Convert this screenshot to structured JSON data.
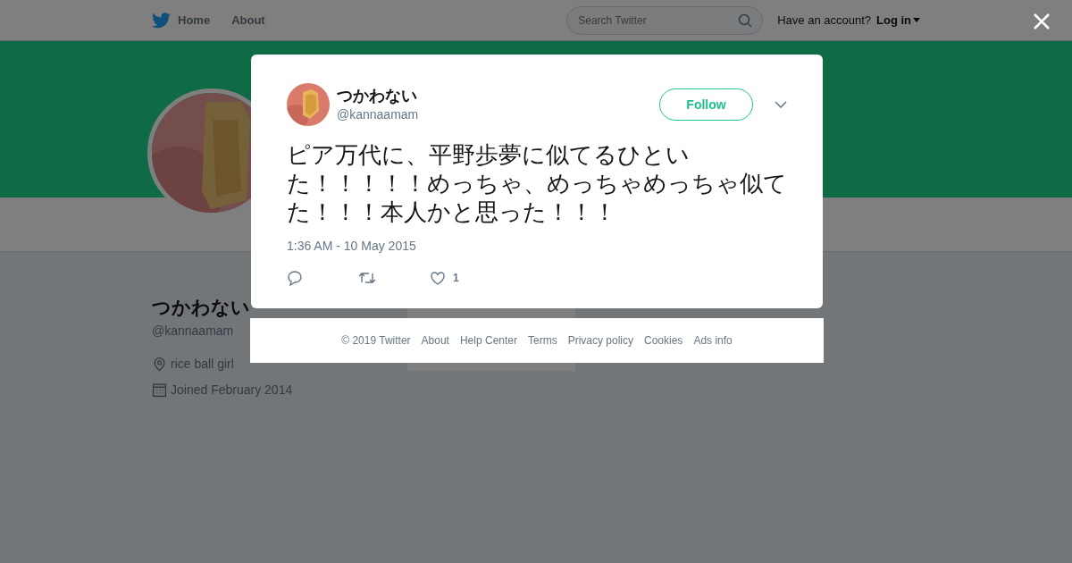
{
  "nav": {
    "links": [
      "Home",
      "About"
    ],
    "search": {
      "placeholder": "Search Twitter"
    },
    "account_prompt": "Have an account?",
    "login": "Log in"
  },
  "profile": {
    "name": "つかわない",
    "handle": "@kannaamam",
    "location": "rice ball girl",
    "joined": "Joined February 2014"
  },
  "tweet": {
    "name": "つかわない",
    "handle": "@kannaamam",
    "follow": "Follow",
    "text": "ピア万代に、平野歩夢に似てるひといた！！！！！めっちゃ、めっちゃめっちゃ似てた！！！本人かと思った！！！",
    "time": "1:36 AM - 10 May 2015",
    "like_count": "1"
  },
  "footer": [
    "© 2019 Twitter",
    "About",
    "Help Center",
    "Terms",
    "Privacy policy",
    "Cookies",
    "Ads info"
  ]
}
